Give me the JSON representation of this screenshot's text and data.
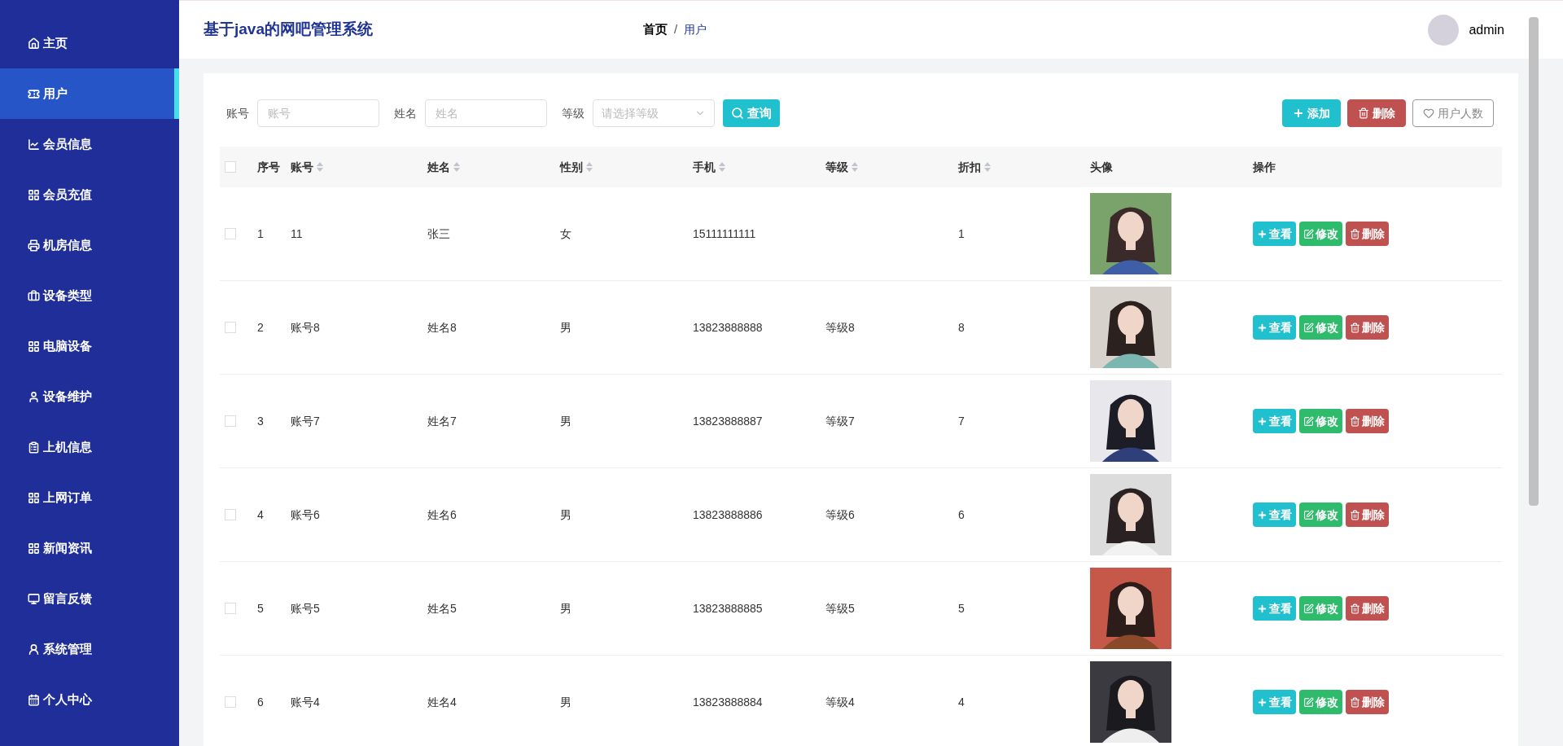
{
  "sidebar": {
    "items": [
      {
        "label": "主页",
        "selected": false
      },
      {
        "label": "用户",
        "selected": true
      },
      {
        "label": "会员信息",
        "selected": false
      },
      {
        "label": "会员充值",
        "selected": false
      },
      {
        "label": "机房信息",
        "selected": false
      },
      {
        "label": "设备类型",
        "selected": false
      },
      {
        "label": "电脑设备",
        "selected": false
      },
      {
        "label": "设备维护",
        "selected": false
      },
      {
        "label": "上机信息",
        "selected": false
      },
      {
        "label": "上网订单",
        "selected": false
      },
      {
        "label": "新闻资讯",
        "selected": false
      },
      {
        "label": "留言反馈",
        "selected": false
      },
      {
        "label": "系统管理",
        "selected": false
      },
      {
        "label": "个人中心",
        "selected": false
      }
    ]
  },
  "header": {
    "title": "基于java的网吧管理系统",
    "breadcrumb": [
      "首页",
      "/",
      "用户"
    ],
    "user": "admin"
  },
  "filters": [
    {
      "label": "账号",
      "placeholder": "账号",
      "kind": "input"
    },
    {
      "label": "姓名",
      "placeholder": "姓名",
      "kind": "input"
    },
    {
      "label": "等级",
      "placeholder": "请选择等级",
      "kind": "select"
    }
  ],
  "search_button": "查询",
  "toolbar": [
    {
      "label": "添加",
      "kind": "add"
    },
    {
      "label": "删除",
      "kind": "delete"
    },
    {
      "label": "用户人数",
      "kind": "count"
    }
  ],
  "table": {
    "all_selected": false,
    "columns": [
      {
        "label": "序号",
        "sortable": false
      },
      {
        "label": "账号",
        "sortable": true
      },
      {
        "label": "姓名",
        "sortable": true
      },
      {
        "label": "性别",
        "sortable": true
      },
      {
        "label": "手机",
        "sortable": true
      },
      {
        "label": "等级",
        "sortable": true
      },
      {
        "label": "折扣",
        "sortable": true
      },
      {
        "label": "头像",
        "sortable": false
      },
      {
        "label": "操作",
        "sortable": false
      }
    ],
    "rows": [
      {
        "selected": false,
        "no": "1",
        "account": "11",
        "name": "张三",
        "gender": "女",
        "phone": "15111111111",
        "discount": "1",
        "actions": [
          {
            "label": "查看",
            "kind": "view"
          },
          {
            "label": "修改",
            "kind": "edit"
          },
          {
            "label": "删除",
            "kind": "delete"
          }
        ]
      },
      {
        "selected": false,
        "no": "2",
        "account": "账号8",
        "name": "姓名8",
        "gender": "男",
        "phone": "13823888888",
        "grade": "等级8",
        "discount": "8",
        "actions": [
          {
            "label": "查看",
            "kind": "view"
          },
          {
            "label": "修改",
            "kind": "edit"
          },
          {
            "label": "删除",
            "kind": "delete"
          }
        ]
      },
      {
        "selected": false,
        "no": "3",
        "account": "账号7",
        "name": "姓名7",
        "gender": "男",
        "phone": "13823888887",
        "grade": "等级7",
        "discount": "7",
        "actions": [
          {
            "label": "查看",
            "kind": "view"
          },
          {
            "label": "修改",
            "kind": "edit"
          },
          {
            "label": "删除",
            "kind": "delete"
          }
        ]
      },
      {
        "selected": false,
        "no": "4",
        "account": "账号6",
        "name": "姓名6",
        "gender": "男",
        "phone": "13823888886",
        "grade": "等级6",
        "discount": "6",
        "actions": [
          {
            "label": "查看",
            "kind": "view"
          },
          {
            "label": "修改",
            "kind": "edit"
          },
          {
            "label": "删除",
            "kind": "delete"
          }
        ]
      },
      {
        "selected": false,
        "no": "5",
        "account": "账号5",
        "name": "姓名5",
        "gender": "男",
        "phone": "13823888885",
        "grade": "等级5",
        "discount": "5",
        "actions": [
          {
            "label": "查看",
            "kind": "view"
          },
          {
            "label": "修改",
            "kind": "edit"
          },
          {
            "label": "删除",
            "kind": "delete"
          }
        ]
      },
      {
        "selected": false,
        "no": "6",
        "account": "账号4",
        "name": "姓名4",
        "gender": "男",
        "phone": "13823888884",
        "grade": "等级4",
        "discount": "4",
        "actions": [
          {
            "label": "查看",
            "kind": "view"
          },
          {
            "label": "修改",
            "kind": "edit"
          },
          {
            "label": "删除",
            "kind": "delete"
          }
        ]
      }
    ]
  }
}
